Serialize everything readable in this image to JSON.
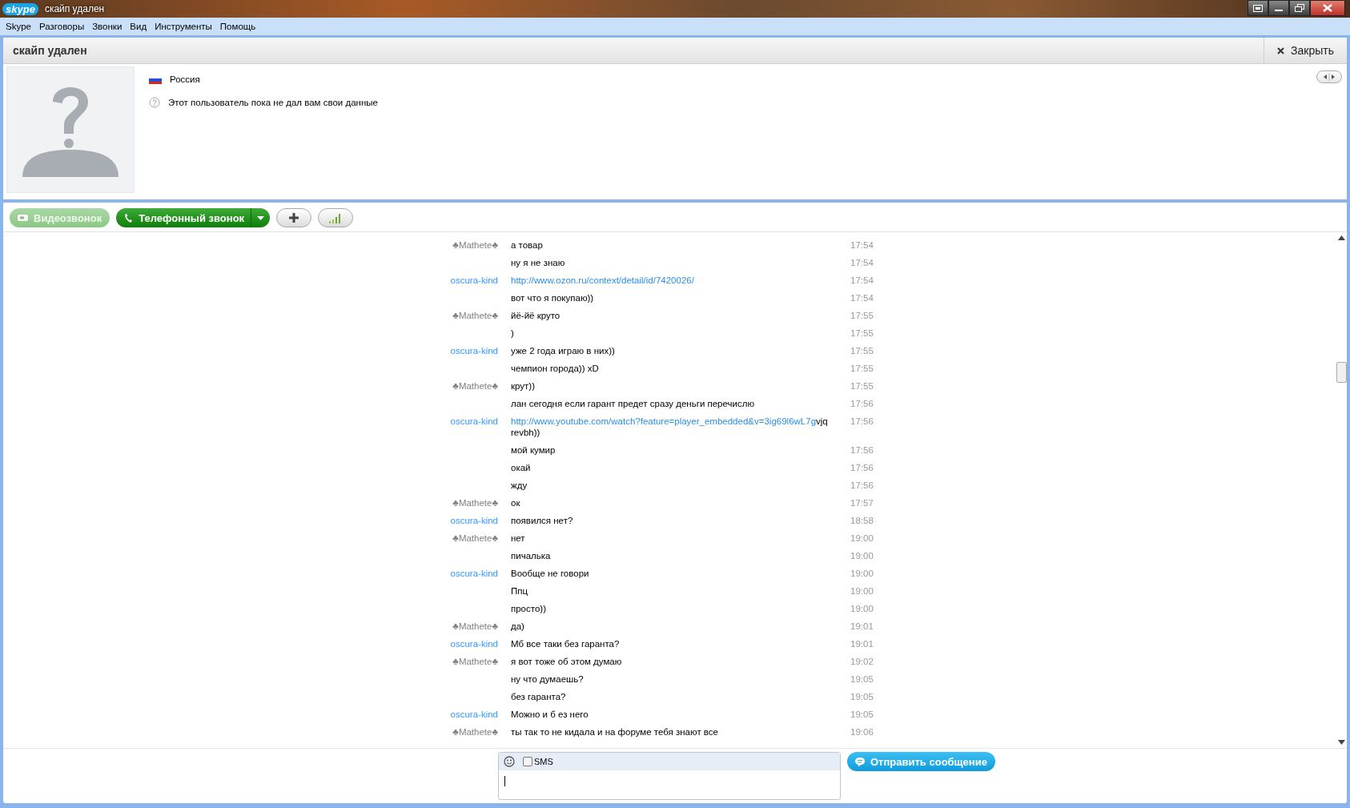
{
  "window": {
    "logo": "skype",
    "title": "скайп удален"
  },
  "menu": [
    "Skype",
    "Разговоры",
    "Звонки",
    "Вид",
    "Инструменты",
    "Помощь"
  ],
  "contact": {
    "name": "скайп удален",
    "close": "Закрыть",
    "country": "Россия",
    "note": "Этот пользователь пока не дал вам свои данные"
  },
  "toolbar": {
    "video_call": {
      "label": "Видеозвонок",
      "disabled": true
    },
    "phone_call": {
      "label": "Телефонный звонок",
      "disabled": false
    }
  },
  "messages": [
    {
      "sender": "♣Mathete♣",
      "color": "#808080",
      "text": "а товар",
      "time": "17:54"
    },
    {
      "text": "ну я не знаю",
      "time": "17:54"
    },
    {
      "sender": "oscura-kind",
      "color": "#3399ff",
      "link": "http://www.ozon.ru/context/detail/id/7420026/",
      "time": "17:54"
    },
    {
      "text": "вот что я покупаю))",
      "time": "17:54"
    },
    {
      "sender": "♣Mathete♣",
      "color": "#808080",
      "text": "йё-йё круто",
      "time": "17:55"
    },
    {
      "text": ")",
      "time": "17:55"
    },
    {
      "sender": "oscura-kind",
      "color": "#3399ff",
      "text": "уже 2 года играю в них))",
      "time": "17:55"
    },
    {
      "text": "чемпион города)) xD",
      "time": "17:55"
    },
    {
      "sender": "♣Mathete♣",
      "color": "#808080",
      "text": "крут))",
      "time": "17:55"
    },
    {
      "text": "лан сегодня если гарант предет сразу деньги перечислю",
      "time": "17:56"
    },
    {
      "sender": "oscura-kind",
      "color": "#3399ff",
      "link": "http://www.youtube.com/watch?feature=player_embedded&v=3ig69l6wL7g",
      "text": "vjq revbh))",
      "time": "17:56"
    },
    {
      "text": "мой кумир",
      "time": "17:56"
    },
    {
      "text": "окай",
      "time": "17:56"
    },
    {
      "text": "жду",
      "time": "17:56"
    },
    {
      "sender": "♣Mathete♣",
      "color": "#808080",
      "text": "ок",
      "time": "17:57"
    },
    {
      "sender": "oscura-kind",
      "color": "#3399ff",
      "text": "появился нет?",
      "time": "18:58"
    },
    {
      "sender": "♣Mathete♣",
      "color": "#808080",
      "text": "нет",
      "time": "19:00"
    },
    {
      "text": "пичалька",
      "time": "19:00"
    },
    {
      "sender": "oscura-kind",
      "color": "#3399ff",
      "text": "Вообще не говори",
      "time": "19:00"
    },
    {
      "text": "Ппц",
      "time": "19:00"
    },
    {
      "text": "просто))",
      "time": "19:00"
    },
    {
      "sender": "♣Mathete♣",
      "color": "#808080",
      "text": "да)",
      "time": "19:01"
    },
    {
      "sender": "oscura-kind",
      "color": "#3399ff",
      "text": "Мб все таки без гаранта?",
      "time": "19:01"
    },
    {
      "sender": "♣Mathete♣",
      "color": "#808080",
      "text": "я вот тоже об этом думаю",
      "time": "19:02"
    },
    {
      "text": "ну что думаешь?",
      "time": "19:05"
    },
    {
      "text": "без гаранта?",
      "time": "19:05"
    },
    {
      "sender": "oscura-kind",
      "color": "#3399ff",
      "text": "Можно и б ез него",
      "time": "19:05"
    },
    {
      "sender": "♣Mathete♣",
      "color": "#808080",
      "text": "ты так то не кидала и на форуме тебя знают все",
      "time": "19:06"
    }
  ],
  "composer": {
    "sms_label": "SMS",
    "sms_checked": false,
    "send": "Отправить сообщение"
  }
}
